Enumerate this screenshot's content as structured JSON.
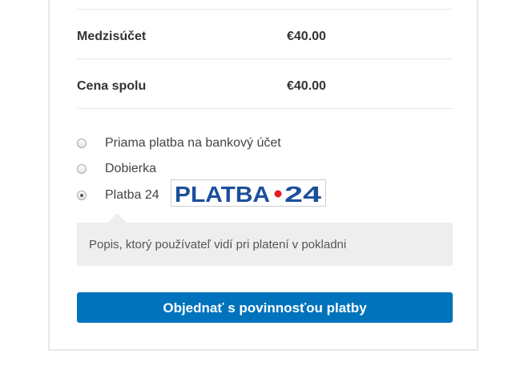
{
  "totals": {
    "subtotal": {
      "label": "Medzisúčet",
      "value": "€40.00"
    },
    "total": {
      "label": "Cena spolu",
      "value": "€40.00"
    }
  },
  "payment_methods": [
    {
      "label": "Priama platba na bankový účet",
      "selected": false
    },
    {
      "label": "Dobierka",
      "selected": false
    },
    {
      "label": "Platba 24",
      "selected": true,
      "logo_text": "PLATBA•24"
    }
  ],
  "payment_description": "Popis, ktorý používateľ vidí pri platení v pokladni",
  "order_button_label": "Objednať s povinnosťou platby",
  "colors": {
    "button": "#0073bd",
    "logo_blue": "#1b4f9c",
    "logo_red": "#e31e24"
  }
}
